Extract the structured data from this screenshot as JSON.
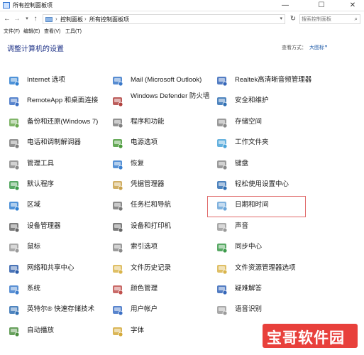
{
  "window": {
    "title": "所有控制面板项",
    "minimize": "—",
    "maximize": "☐",
    "close": "✕"
  },
  "address": {
    "crumbs": [
      "控制面板",
      "所有控制面板项"
    ],
    "separator": "›",
    "search_placeholder": "搜索控制面板"
  },
  "menu": [
    "文件(F)",
    "编辑(E)",
    "查看(V)",
    "工具(T)"
  ],
  "header": {
    "title": "调整计算机的设置",
    "view_by_label": "查看方式：",
    "view_by_value": "大图标",
    "view_by_arrow": "▾"
  },
  "items": {
    "col1": [
      {
        "label": "Internet 选项",
        "icon": "internet-options-icon",
        "color": "#2f7fd1"
      },
      {
        "label": "RemoteApp 和桌面连接",
        "icon": "remoteapp-icon",
        "color": "#3b6fc4"
      },
      {
        "label": "备份和还原(Windows 7)",
        "icon": "backup-icon",
        "color": "#6aa84f"
      },
      {
        "label": "电话和调制解调器",
        "icon": "phone-modem-icon",
        "color": "#7f7f7f"
      },
      {
        "label": "管理工具",
        "icon": "admin-tools-icon",
        "color": "#8a8a8a"
      },
      {
        "label": "默认程序",
        "icon": "default-programs-icon",
        "color": "#3c9a4a"
      },
      {
        "label": "区域",
        "icon": "region-icon",
        "color": "#2f7fd1"
      },
      {
        "label": "设备管理器",
        "icon": "device-manager-icon",
        "color": "#666666"
      },
      {
        "label": "鼠标",
        "icon": "mouse-icon",
        "color": "#9a9a9a"
      },
      {
        "label": "网络和共享中心",
        "icon": "network-icon",
        "color": "#2a5caa"
      },
      {
        "label": "系统",
        "icon": "system-icon",
        "color": "#3d7dcc"
      },
      {
        "label": "英特尔® 快速存储技术",
        "icon": "intel-rst-icon",
        "color": "#2f6fb3"
      },
      {
        "label": "自动播放",
        "icon": "autoplay-icon",
        "color": "#4c8f3f"
      }
    ],
    "col2": [
      {
        "label": "Mail (Microsoft Outlook)",
        "icon": "mail-icon",
        "color": "#3a78c9"
      },
      {
        "label": "Windows Defender 防火墙",
        "icon": "firewall-icon",
        "color": "#b0413e"
      },
      {
        "label": "程序和功能",
        "icon": "programs-features-icon",
        "color": "#7f7f7f"
      },
      {
        "label": "电源选项",
        "icon": "power-options-icon",
        "color": "#4a9a3a"
      },
      {
        "label": "恢复",
        "icon": "recovery-icon",
        "color": "#3a7fcf"
      },
      {
        "label": "凭据管理器",
        "icon": "credential-manager-icon",
        "color": "#c9a14a"
      },
      {
        "label": "任务栏和导航",
        "icon": "taskbar-icon",
        "color": "#777777"
      },
      {
        "label": "设备和打印机",
        "icon": "devices-printers-icon",
        "color": "#666666"
      },
      {
        "label": "索引选项",
        "icon": "indexing-icon",
        "color": "#8a8a8a"
      },
      {
        "label": "文件历史记录",
        "icon": "file-history-icon",
        "color": "#d9b44a"
      },
      {
        "label": "颜色管理",
        "icon": "color-management-icon",
        "color": "#c0504d"
      },
      {
        "label": "用户帐户",
        "icon": "user-accounts-icon",
        "color": "#3b6fc4"
      },
      {
        "label": "字体",
        "icon": "fonts-icon",
        "color": "#d4a93a"
      }
    ],
    "col3": [
      {
        "label": "Realtek高清晰音频管理器",
        "icon": "realtek-audio-icon",
        "color": "#3566b8"
      },
      {
        "label": "安全和维护",
        "icon": "security-maintenance-icon",
        "color": "#2f6fb3"
      },
      {
        "label": "存储空间",
        "icon": "storage-spaces-icon",
        "color": "#888888"
      },
      {
        "label": "工作文件夹",
        "icon": "work-folders-icon",
        "color": "#4aa3d8"
      },
      {
        "label": "键盘",
        "icon": "keyboard-icon",
        "color": "#8a8a8a"
      },
      {
        "label": "轻松使用设置中心",
        "icon": "ease-of-access-icon",
        "color": "#2f6fb3"
      },
      {
        "label": "日期和时间",
        "icon": "date-time-icon",
        "color": "#6aa5d8"
      },
      {
        "label": "声音",
        "icon": "sound-icon",
        "color": "#9a9a9a"
      },
      {
        "label": "同步中心",
        "icon": "sync-center-icon",
        "color": "#3c9a4a"
      },
      {
        "label": "文件资源管理器选项",
        "icon": "file-explorer-options-icon",
        "color": "#d9b44a"
      },
      {
        "label": "疑难解答",
        "icon": "troubleshooting-icon",
        "color": "#3566b8"
      },
      {
        "label": "语音识别",
        "icon": "speech-recognition-icon",
        "color": "#9a9a9a"
      }
    ]
  },
  "watermark": "宝哥软件园"
}
